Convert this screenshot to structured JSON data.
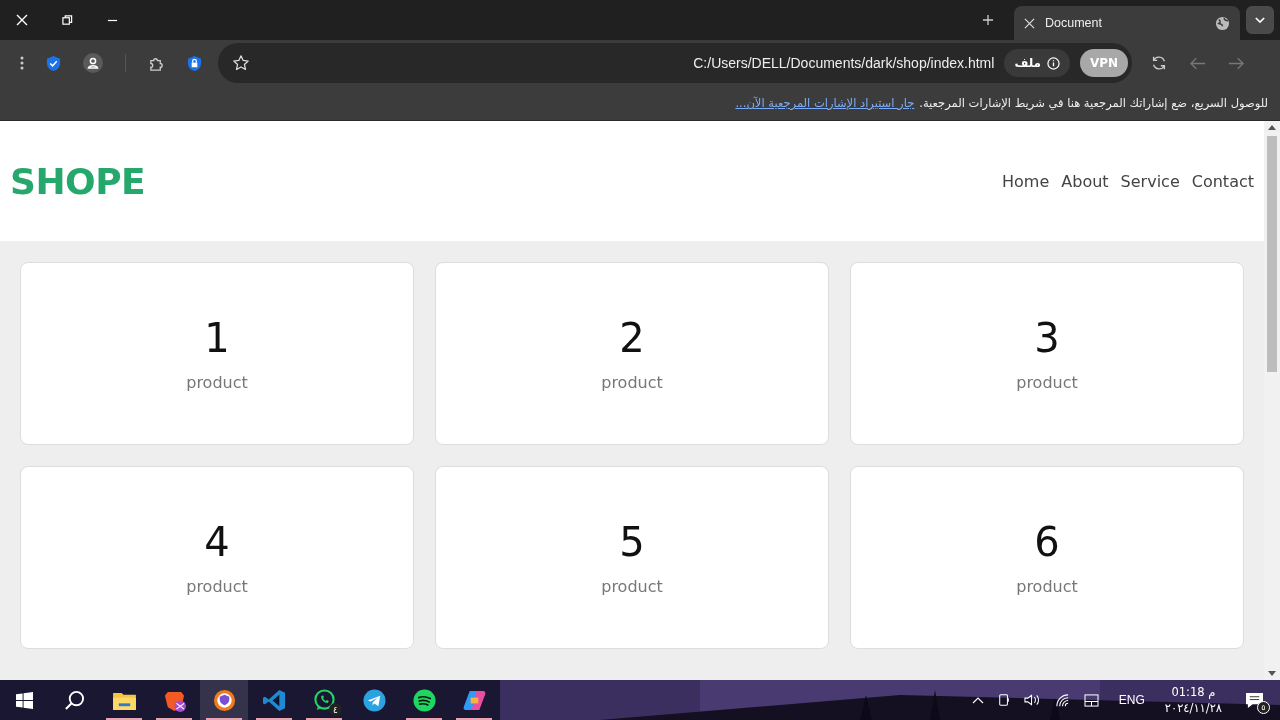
{
  "browser": {
    "tab": {
      "title": "Document",
      "selected": true
    },
    "address": "C:/Users/DELL/Documents/dark/shop/index.html",
    "file_chip": "ملف",
    "vpn": "VPN",
    "bookmarks_hint": "للوصول السريع، ضع إشاراتك المرجعية هنا في شريط الإشارات المرجعية.",
    "bookmarks_link": "جار استيراد الإشارات المرجعية الآن..."
  },
  "page": {
    "logo": "SHOPE",
    "nav": [
      {
        "label": "Home"
      },
      {
        "label": "About"
      },
      {
        "label": "Service"
      },
      {
        "label": "Contact"
      }
    ],
    "products": [
      {
        "number": "1",
        "label": "product"
      },
      {
        "number": "2",
        "label": "product"
      },
      {
        "number": "3",
        "label": "product"
      },
      {
        "number": "4",
        "label": "product"
      },
      {
        "number": "5",
        "label": "product"
      },
      {
        "number": "6",
        "label": "product"
      }
    ]
  },
  "taskbar": {
    "apps": [
      {
        "kind": "explorer",
        "running": true,
        "selected": false
      },
      {
        "kind": "brave",
        "running": true,
        "selected": false
      },
      {
        "kind": "browser",
        "running": true,
        "selected": true
      },
      {
        "kind": "vscode",
        "running": true,
        "selected": false
      },
      {
        "kind": "whatsapp",
        "running": true,
        "selected": false,
        "badge": "٤"
      },
      {
        "kind": "telegram",
        "running": false,
        "selected": false
      },
      {
        "kind": "spotify",
        "running": true,
        "selected": false
      },
      {
        "kind": "copilot",
        "running": true,
        "selected": false
      }
    ],
    "language": "ENG",
    "time": "01:18 م",
    "date": "٢٠٢٤/١١/٢٨",
    "notifications": "٥"
  }
}
